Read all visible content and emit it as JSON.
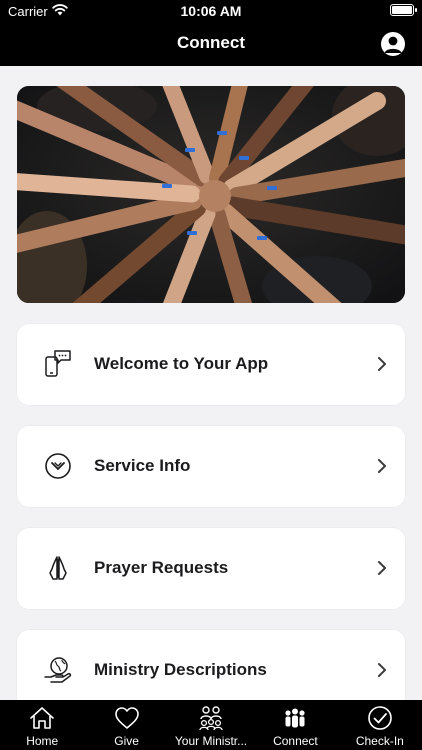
{
  "status_bar": {
    "carrier": "Carrier",
    "time": "10:06 AM"
  },
  "header": {
    "title": "Connect",
    "profile_icon": "person-icon"
  },
  "hero": {
    "image": "hands-together-photo"
  },
  "cards": [
    {
      "label": "Welcome to Your App",
      "icon": "phone-chat-icon"
    },
    {
      "label": "Service Info",
      "icon": "chevron-circle-icon"
    },
    {
      "label": "Prayer Requests",
      "icon": "praying-hands-icon"
    },
    {
      "label": "Ministry Descriptions",
      "icon": "globe-hand-icon"
    }
  ],
  "tabs": [
    {
      "label": "Home",
      "icon": "home-icon"
    },
    {
      "label": "Give",
      "icon": "heart-icon"
    },
    {
      "label": "Your Ministr...",
      "icon": "people-group-icon"
    },
    {
      "label": "Connect",
      "icon": "people-icon",
      "active": true
    },
    {
      "label": "Check-In",
      "icon": "checkmark-circle-icon"
    }
  ],
  "colors": {
    "bars": "#000000",
    "background": "#f2f2f4",
    "card": "#ffffff",
    "text": "#1c1c1e",
    "chevron": "#8e8e93"
  }
}
